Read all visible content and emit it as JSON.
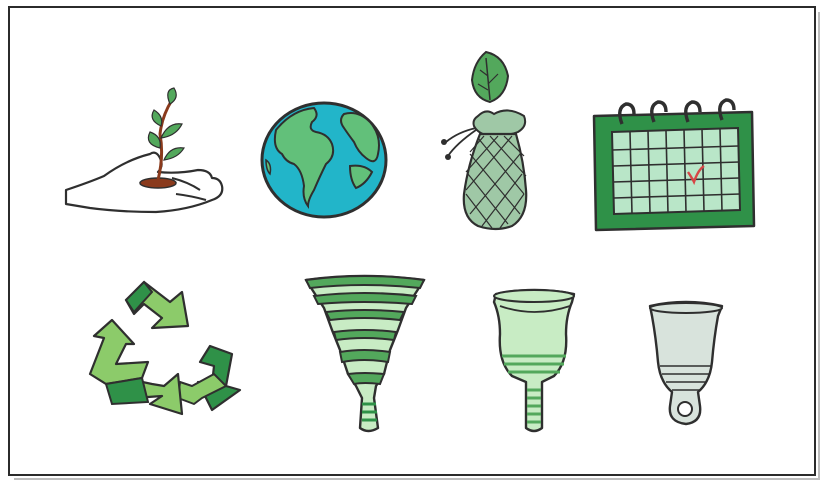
{
  "palette": {
    "outline": "#2f2f2f",
    "dark_green": "#2f9148",
    "mid_green": "#53a85c",
    "light_green": "#8ccb6a",
    "pale_green": "#c8ecc4",
    "mint": "#b9e6c8",
    "ocean": "#22b5c9",
    "soil": "#8a3a1c",
    "grey_cup": "#d8e3dc",
    "heart": "#d64545"
  },
  "icons": [
    {
      "name": "hand-holding-seedling-icon"
    },
    {
      "name": "earth-globe-icon"
    },
    {
      "name": "mesh-produce-bag-icon"
    },
    {
      "name": "calendar-icon"
    },
    {
      "name": "recycle-arrows-icon"
    },
    {
      "name": "funnel-icon"
    },
    {
      "name": "menstrual-cup-icon"
    },
    {
      "name": "menstrual-cup-ring-icon"
    }
  ]
}
